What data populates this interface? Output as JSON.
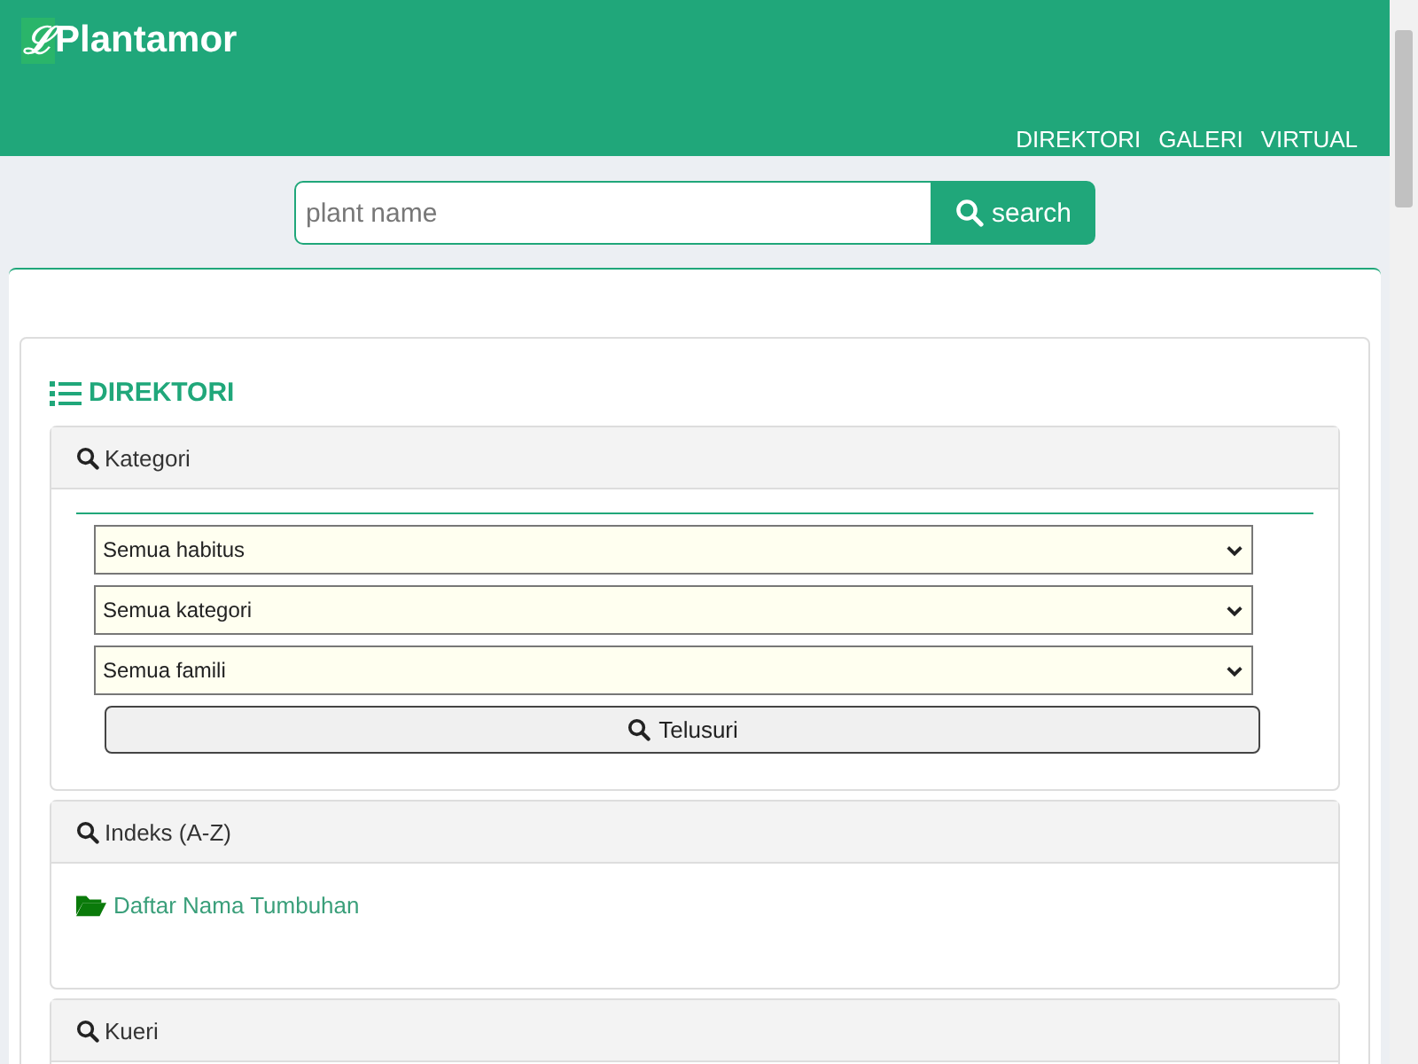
{
  "header": {
    "logo_mark": "ℒ",
    "logo_text": "Plantamor",
    "nav": [
      "DIREKTORI",
      "GALERI",
      "VIRTUAL"
    ]
  },
  "search": {
    "placeholder": "plant name",
    "button": "search"
  },
  "directory": {
    "title": "DIREKTORI",
    "sections": [
      {
        "kind": "filters",
        "title": "Kategori",
        "selects": [
          "Semua habitus",
          "Semua kategori",
          "Semua famili"
        ],
        "button": "Telusuri"
      },
      {
        "kind": "links",
        "title": "Indeks (A-Z)",
        "links": [
          "Daftar Nama Tumbuhan"
        ]
      },
      {
        "kind": "empty",
        "title": "Kueri"
      }
    ]
  }
}
